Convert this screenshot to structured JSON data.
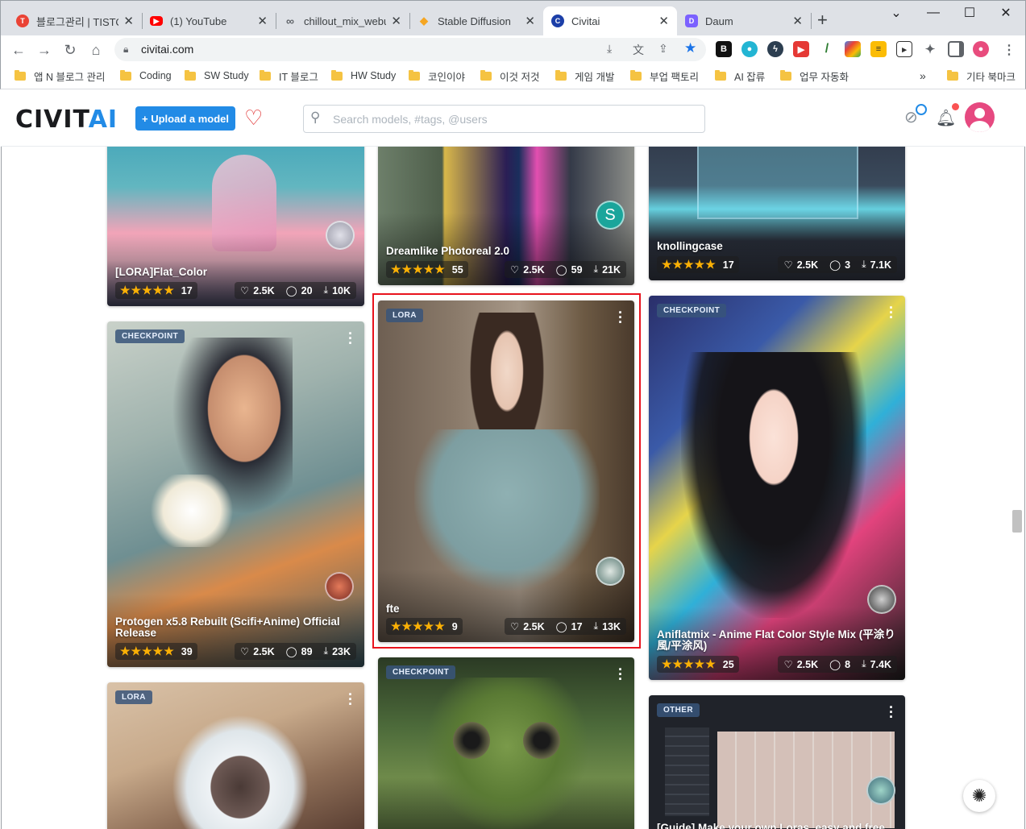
{
  "browser": {
    "tabs": [
      {
        "title": "블로그관리 | TISTO",
        "color": "#ea4335",
        "glyph": "T"
      },
      {
        "title": "(1) YouTube",
        "color": "#ff0000",
        "glyph": "▶"
      },
      {
        "title": "chillout_mix_webui",
        "color": "#5f6368",
        "glyph": "∞"
      },
      {
        "title": "Stable Diffusion",
        "color": "#f5a623",
        "glyph": "◆"
      },
      {
        "title": "Civitai",
        "color": "#1c3fa8",
        "glyph": "C"
      },
      {
        "title": "Daum",
        "color": "#7b61ff",
        "glyph": "D"
      }
    ],
    "new_tab": "+",
    "url": "civitai.com",
    "bookmarks": [
      "앱 N 블로그 관리",
      "Coding",
      "SW Study",
      "IT 블로그",
      "HW Study",
      "코인이야",
      "이것 저것",
      "게임 개발",
      "부업 팩토리",
      "AI 잡류",
      "업무 자동화"
    ],
    "bookmarks_more": "»",
    "other_bookmarks": "기타 북마크"
  },
  "site": {
    "logo_main": "CIVIT",
    "logo_accent": "AI",
    "upload_label": "+ Upload a model",
    "search_placeholder": "Search models, #tags, @users",
    "accent": "#228be6"
  },
  "cards": [
    {
      "id": "flat-color",
      "title": "[LORA]Flat_Color",
      "stars": "★★★★★",
      "rating_count": "17",
      "likes": "2.5K",
      "comments": "20",
      "downloads": "10K"
    },
    {
      "id": "dreamlike",
      "title": "Dreamlike Photoreal 2.0",
      "stars": "★★★★★",
      "rating_count": "55",
      "likes": "2.5K",
      "comments": "59",
      "downloads": "21K",
      "avatar_letter": "S"
    },
    {
      "id": "knollingcase",
      "title": "knollingcase",
      "stars": "★★★★★",
      "rating_count": "17",
      "likes": "2.5K",
      "comments": "3",
      "downloads": "7.1K"
    },
    {
      "id": "protogen",
      "badge": "CHECKPOINT",
      "title": "Protogen x5.8 Rebuilt (Scifi+Anime) Official Release",
      "stars": "★★★★★",
      "rating_count": "39",
      "likes": "2.5K",
      "comments": "89",
      "downloads": "23K"
    },
    {
      "id": "fte",
      "badge": "LORA",
      "title": "fte",
      "stars": "★★★★★",
      "rating_count": "9",
      "likes": "2.5K",
      "comments": "17",
      "downloads": "13K"
    },
    {
      "id": "aniflatmix",
      "badge": "CHECKPOINT",
      "title": "Aniflatmix - Anime Flat Color Style Mix (平涂り風/平涂风)",
      "stars": "★★★★★",
      "rating_count": "25",
      "likes": "2.5K",
      "comments": "8",
      "downloads": "7.4K"
    },
    {
      "id": "lora-bottom",
      "badge": "LORA"
    },
    {
      "id": "checkpoint-bottom",
      "badge": "CHECKPOINT"
    },
    {
      "id": "guide",
      "badge": "OTHER",
      "title": "[Guide] Make your own Loras, easy and free"
    }
  ]
}
